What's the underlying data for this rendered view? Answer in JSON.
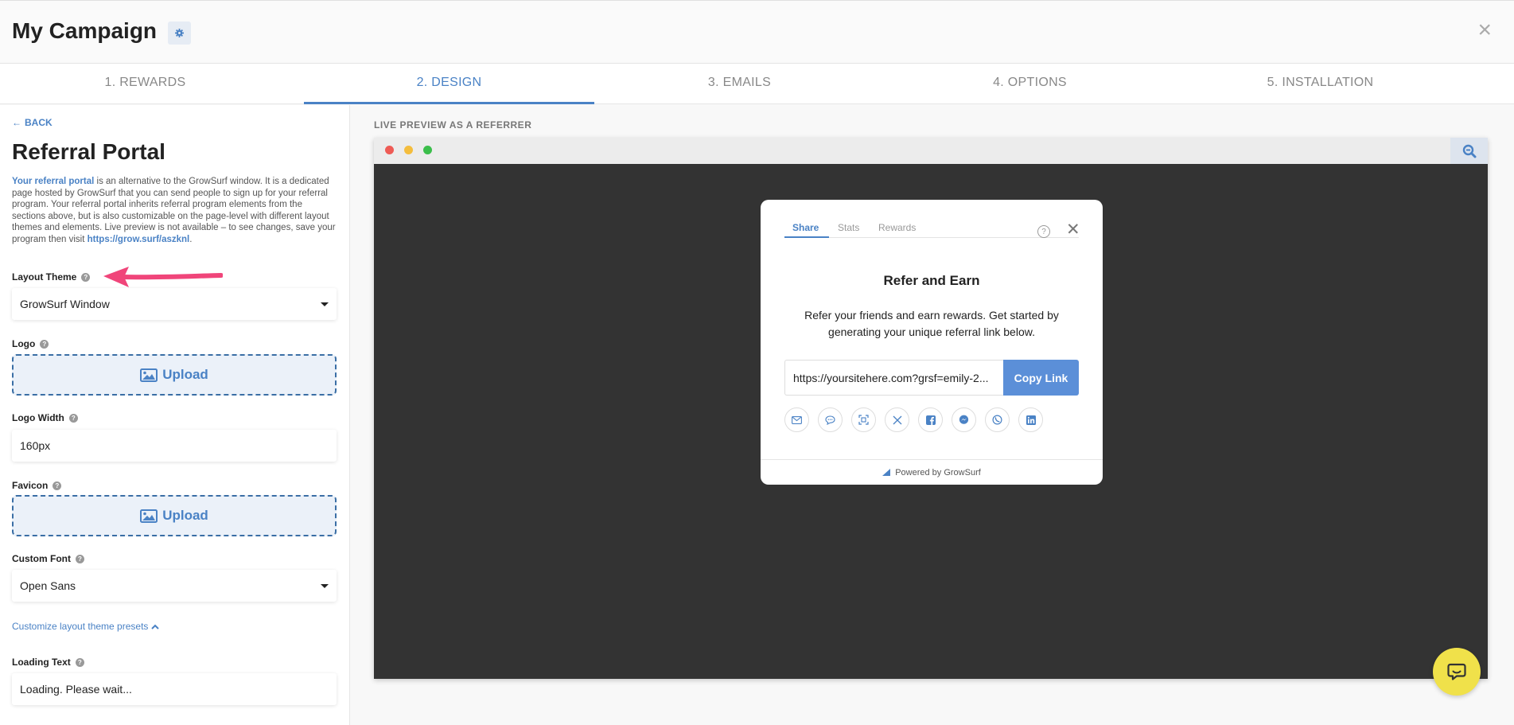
{
  "header": {
    "title": "My Campaign",
    "close_symbol": "×"
  },
  "tabs": [
    {
      "label": "1. REWARDS"
    },
    {
      "label": "2. DESIGN"
    },
    {
      "label": "3. EMAILS"
    },
    {
      "label": "4. OPTIONS"
    },
    {
      "label": "5. INSTALLATION"
    }
  ],
  "sidebar": {
    "back": "BACK",
    "title": "Referral Portal",
    "desc_link": "Your referral portal",
    "desc_text": " is an alternative to the GrowSurf window. It is a dedicated page hosted by GrowSurf that you can send people to sign up for your referral program. Your referral portal inherits referral program elements from the sections above, but is also customizable on the page-level with different layout themes and elements. Live preview is not available – to see changes, save your program then visit ",
    "desc_url": "https://grow.surf/aszknl",
    "desc_end": ".",
    "layout_theme": {
      "label": "Layout Theme",
      "value": "GrowSurf Window"
    },
    "logo": {
      "label": "Logo",
      "button": "Upload"
    },
    "logo_width": {
      "label": "Logo Width",
      "value": "160px"
    },
    "favicon": {
      "label": "Favicon",
      "button": "Upload"
    },
    "custom_font": {
      "label": "Custom Font",
      "value": "Open Sans"
    },
    "customize_link": "Customize layout theme presets",
    "loading_text": {
      "label": "Loading Text",
      "value": "Loading. Please wait..."
    }
  },
  "preview": {
    "label": "LIVE PREVIEW AS A REFERRER",
    "modal": {
      "tabs": [
        "Share",
        "Stats",
        "Rewards"
      ],
      "heading": "Refer and Earn",
      "text": "Refer your friends and earn rewards. Get started by generating your unique referral link below.",
      "link": "https://yoursitehere.com?grsf=emily-2...",
      "copy_button": "Copy Link",
      "footer": "Powered by GrowSurf",
      "share_icons": [
        "email-icon",
        "sms-icon",
        "qr-code-icon",
        "x-icon",
        "facebook-icon",
        "messenger-icon",
        "whatsapp-icon",
        "linkedin-icon"
      ]
    }
  },
  "colors": {
    "accent": "#4a82c5",
    "copy_button": "#5b8fd8",
    "chat": "#f0e14a",
    "arrow": "#f0457a"
  }
}
